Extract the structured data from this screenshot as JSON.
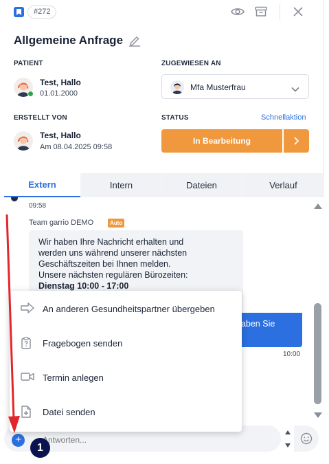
{
  "header": {
    "ticket_id": "#272",
    "title": "Allgemeine Anfrage"
  },
  "patient": {
    "label": "PATIENT",
    "name": "Test, Hallo",
    "dob": "01.01.2000"
  },
  "assigned": {
    "label": "ZUGEWIESEN AN",
    "name": "Mfa Musterfrau"
  },
  "created_by": {
    "label": "ERSTELLT VON",
    "name": "Test, Hallo",
    "date": "Am 08.04.2025 09:58"
  },
  "status": {
    "label": "STATUS",
    "quick_action": "Schnellaktion",
    "value": "In Bearbeitung",
    "accent_color": "#f0983d"
  },
  "tabs": [
    {
      "label": "Extern",
      "active": true
    },
    {
      "label": "Intern",
      "active": false
    },
    {
      "label": "Dateien",
      "active": false
    },
    {
      "label": "Verlauf",
      "active": false
    }
  ],
  "chat": {
    "first_time": "09:58",
    "sender": "Team garrio DEMO",
    "auto_badge": "Auto",
    "message_lines": [
      "Wir haben Ihre Nachricht erhalten und",
      "werden uns während unserer nächsten",
      "Geschäftszeiten bei Ihnen melden.",
      "Unsere nächsten regulären Bürozeiten:"
    ],
    "message_bold": "Dienstag 10:00 - 17:00",
    "outgoing_text": "haben Sie",
    "outgoing_time": "10:00"
  },
  "composer": {
    "placeholder": "Antworten...",
    "plus": "+"
  },
  "menu": {
    "items": [
      {
        "label": "An anderen Gesundheitspartner übergeben",
        "icon": "arrow-right-icon"
      },
      {
        "label": "Fragebogen senden",
        "icon": "clipboard-question-icon"
      },
      {
        "label": "Termin anlegen",
        "icon": "video-camera-icon"
      },
      {
        "label": "Datei senden",
        "icon": "file-add-icon"
      }
    ]
  },
  "annotation": {
    "step": "1",
    "arrow_color": "#e3262b"
  },
  "colors": {
    "primary": "#2b6fe0",
    "orange": "#f0983d"
  }
}
